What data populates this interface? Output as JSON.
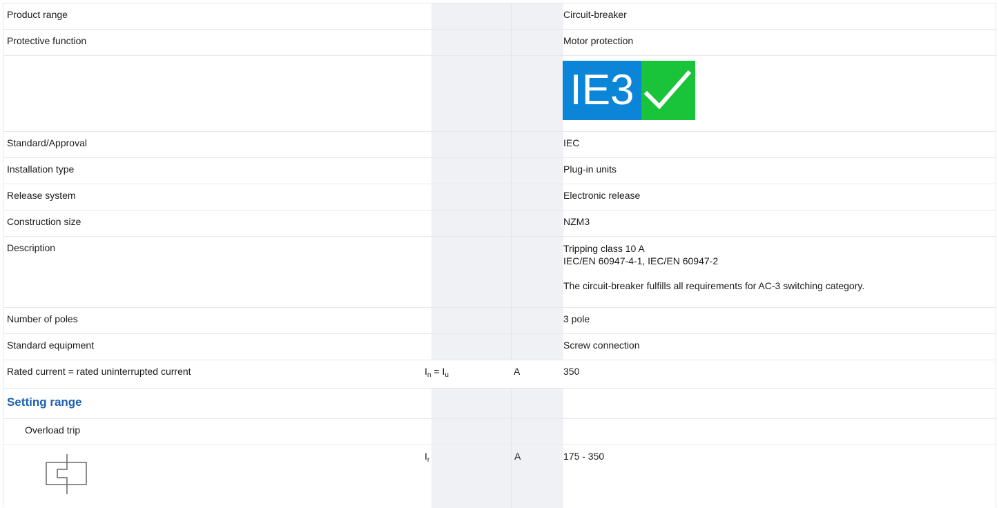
{
  "rows": [
    {
      "label": "Product range",
      "symbol": "",
      "unit": "",
      "value": "Circuit-breaker"
    },
    {
      "label": "Protective function",
      "symbol": "",
      "unit": "",
      "value": "Motor protection"
    },
    {
      "label": "Standard/Approval",
      "symbol": "",
      "unit": "",
      "value": "IEC"
    },
    {
      "label": "Installation type",
      "symbol": "",
      "unit": "",
      "value": "Plug-in units"
    },
    {
      "label": "Release system",
      "symbol": "",
      "unit": "",
      "value": "Electronic release"
    },
    {
      "label": "Construction size",
      "symbol": "",
      "unit": "",
      "value": "NZM3"
    },
    {
      "label": "Number of poles",
      "symbol": "",
      "unit": "",
      "value": "3 pole"
    },
    {
      "label": "Standard equipment",
      "symbol": "",
      "unit": "",
      "value": "Screw connection"
    }
  ],
  "badge": {
    "text": "IE3",
    "colors": {
      "ie": "#0a85d8",
      "check": "#19c43a"
    }
  },
  "description": {
    "label": "Description",
    "line1": "Tripping class 10 A",
    "line2": "IEC/EN 60947-4-1, IEC/EN 60947-2",
    "line3": "The circuit-breaker fulfills all requirements for AC-3 switching category."
  },
  "rated_current": {
    "label": "Rated current = rated uninterrupted current",
    "symbol_main": "I",
    "symbol_sub1": "n",
    "symbol_eq": " = I",
    "symbol_sub2": "u",
    "unit": "A",
    "value": "350"
  },
  "section": {
    "heading": "Setting range"
  },
  "overload": {
    "label": "Overload trip"
  },
  "ir": {
    "symbol_main": "I",
    "symbol_sub": "r",
    "unit": "A",
    "value": "175 - 350",
    "icon": "overload-relay-icon"
  },
  "accent_color": "#1c5fb0"
}
